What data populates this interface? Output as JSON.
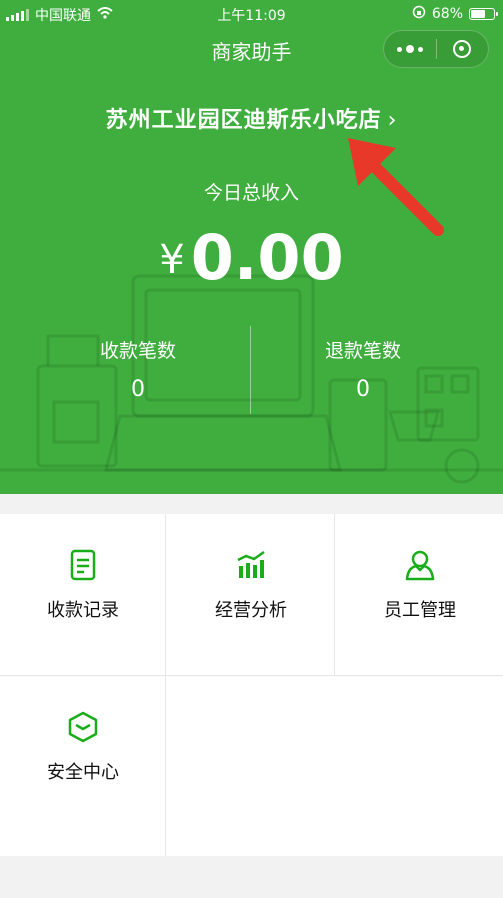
{
  "status_bar": {
    "carrier": "中国联通",
    "time": "上午11:09",
    "battery_percent": "68%",
    "battery_level": 0.68
  },
  "nav": {
    "title": "商家助手",
    "more_icon": "more-dots-icon",
    "close_icon": "target-close-icon"
  },
  "store": {
    "name": "苏州工业园区迪斯乐小吃店",
    "chevron": "›"
  },
  "summary": {
    "income_label": "今日总收入",
    "currency": "¥",
    "income_value": "0.00",
    "collect_label": "收款笔数",
    "collect_count": "0",
    "refund_label": "退款笔数",
    "refund_count": "0"
  },
  "menu": [
    {
      "label": "收款记录",
      "icon": "receipt-icon"
    },
    {
      "label": "经营分析",
      "icon": "bar-chart-icon"
    },
    {
      "label": "员工管理",
      "icon": "user-icon"
    },
    {
      "label": "安全中心",
      "icon": "shield-icon"
    }
  ],
  "colors": {
    "brand_green": "#3fae3e",
    "icon_green": "#1aad19",
    "annotation_arrow": "#e8382a"
  }
}
